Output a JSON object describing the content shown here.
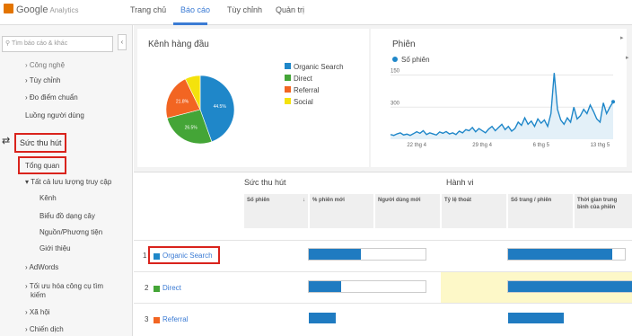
{
  "app": {
    "logo_text": "Google",
    "logo_sub": "Analytics"
  },
  "nav": {
    "items": [
      {
        "label": "Trang chủ",
        "left": 0
      },
      {
        "label": "Báo cáo",
        "left": 56,
        "active": true
      },
      {
        "label": "Tùy chỉnh",
        "left": 108
      },
      {
        "label": "Quản trị",
        "left": 162
      }
    ]
  },
  "sidebar": {
    "search_placeholder": "Tìm báo cáo & khác",
    "collapse_label": "‹",
    "items": [
      {
        "label": "› Công nghệ"
      },
      {
        "label": "› Tùy chỉnh"
      },
      {
        "label": "› Đo điểm chuẩn"
      },
      {
        "label": "Luồng người dùng"
      },
      {
        "label": "Sức thu hút"
      },
      {
        "label": "Tổng quan"
      },
      {
        "label": "▾ Tất cả lưu lượng truy cập"
      },
      {
        "label": "Kênh"
      },
      {
        "label": "Biểu đồ dạng cây"
      },
      {
        "label": "Nguồn/Phương tiện"
      },
      {
        "label": "Giới thiệu"
      },
      {
        "label": "› AdWords"
      },
      {
        "label": "› Tối ưu hóa công cụ tìm"
      },
      {
        "label": "kiếm"
      },
      {
        "label": "› Xã hội"
      },
      {
        "label": "› Chiến dịch"
      }
    ]
  },
  "top_channels": {
    "title": "Kênh hàng đầu",
    "legend": [
      {
        "label": "Organic Search",
        "color": "#1f87c9"
      },
      {
        "label": "Direct",
        "color": "#44a537"
      },
      {
        "label": "Referral",
        "color": "#f26522"
      },
      {
        "label": "Social",
        "color": "#f4e20c"
      }
    ],
    "slice_labels": [
      "44.5%",
      "26.5%",
      "21.8%"
    ]
  },
  "sessions": {
    "title": "Phiên",
    "legend_label": "Số phiên",
    "y_ticks": [
      "300",
      "150"
    ],
    "x_ticks": [
      "22 thg 4",
      "29 thg 4",
      "6 thg 5",
      "13 thg 5"
    ]
  },
  "table": {
    "group_acq": "Sức thu hút",
    "group_behavior": "Hành vi",
    "headers": [
      "Số phiên",
      "% phiên mới",
      "Người dùng mới",
      "Tỷ lệ thoát",
      "Số trang / phiên",
      "Thời gian trung bình của phiên"
    ],
    "sort_icon": "↓",
    "rows": [
      {
        "num": "1",
        "label": "Organic Search",
        "color": "#1f87c9"
      },
      {
        "num": "2",
        "label": "Direct",
        "color": "#44a537"
      },
      {
        "num": "3",
        "label": "Referral",
        "color": "#f26522"
      }
    ]
  },
  "chart_data": [
    {
      "type": "pie",
      "title": "Kênh hàng đầu",
      "categories": [
        "Organic Search",
        "Direct",
        "Referral",
        "Social"
      ],
      "values": [
        44.5,
        26.5,
        21.8,
        7.2
      ],
      "colors": [
        "#1f87c9",
        "#44a537",
        "#f26522",
        "#f4e20c"
      ],
      "legend": "right"
    },
    {
      "type": "area",
      "title": "Phiên",
      "series": [
        {
          "name": "Số phiên",
          "values": [
            22,
            18,
            25,
            30,
            20,
            24,
            18,
            26,
            35,
            28,
            40,
            22,
            30,
            25,
            20,
            34,
            28,
            36,
            25,
            30,
            22,
            38,
            30,
            45,
            40,
            55,
            35,
            50,
            40,
            30,
            48,
            60,
            40,
            55,
            70,
            45,
            60,
            38,
            50,
            80,
            65,
            100,
            70,
            85,
            60,
            95,
            75,
            90,
            60,
            120,
            310,
            140,
            90,
            70,
            100,
            80,
            150,
            95,
            110,
            140,
            120,
            160,
            130,
            95,
            80,
            170,
            120,
            150,
            175
          ]
        }
      ],
      "x_ticks": [
        "22 thg 4",
        "29 thg 4",
        "6 thg 5",
        "13 thg 5"
      ],
      "ylim": [
        0,
        340
      ],
      "y_ticks": [
        150,
        300
      ],
      "grid": true
    }
  ]
}
